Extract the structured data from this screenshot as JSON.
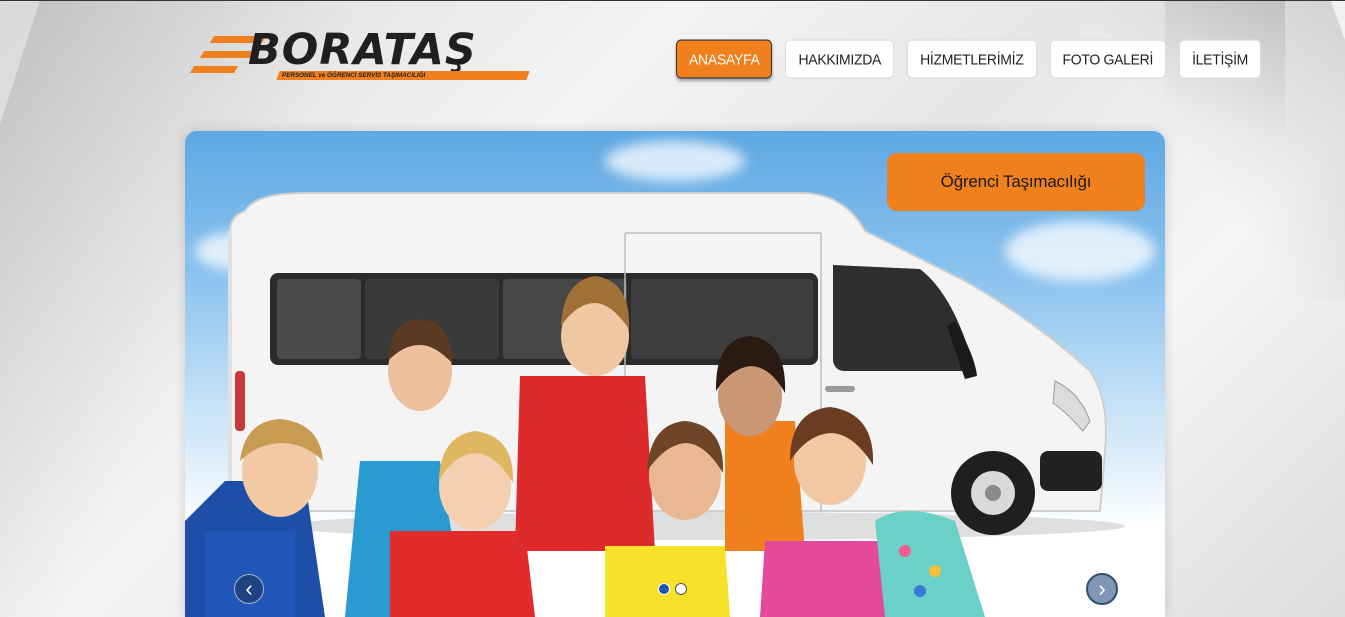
{
  "brand": {
    "name": "BORATAŞ",
    "tagline": "PERSONEL ve ÖĞRENCİ SERVİS TAŞIMACILIĞI",
    "accent_color": "#f07f1d"
  },
  "nav": {
    "items": [
      {
        "label": "ANASAYFA",
        "active": true
      },
      {
        "label": "HAKKIMIZDA",
        "active": false
      },
      {
        "label": "HİZMETLERİMİZ",
        "active": false
      },
      {
        "label": "FOTO GALERİ",
        "active": false
      },
      {
        "label": "İLETİŞİM",
        "active": false
      }
    ]
  },
  "slider": {
    "caption": "Öğrenci Taşımacılığı",
    "prev_icon": "chevron-left-icon",
    "next_icon": "chevron-right-icon",
    "slide_count": 2,
    "current_slide": 1,
    "image_subject": "white minibus with smiling children giving thumbs up"
  }
}
